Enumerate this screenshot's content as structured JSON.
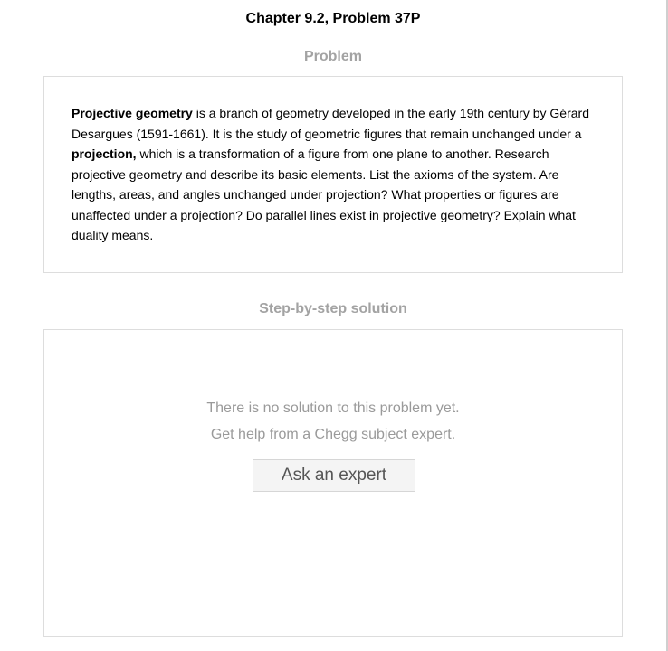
{
  "chapter_title": "Chapter 9.2, Problem 37P",
  "problem": {
    "heading": "Problem",
    "term_bold": "Projective geometry",
    "text_part1": " is a branch of geometry developed in the early 19th century by Gérard Desargues (1591-1661). It is the study of geometric figures that remain unchanged under a ",
    "projection_bold": "projection,",
    "text_part2": " which is a transformation of a figure from one plane to another. Research projective geometry and describe its basic elements. List the axioms of the system. Are lengths, areas, and angles unchanged under projection? What properties or figures are unaffected under a projection? Do parallel lines exist in projective geometry? Explain what duality means."
  },
  "solution": {
    "heading": "Step-by-step solution",
    "no_solution_line1": "There is no solution to this problem yet.",
    "no_solution_line2": "Get help from a Chegg subject expert.",
    "ask_button_label": "Ask an expert"
  }
}
